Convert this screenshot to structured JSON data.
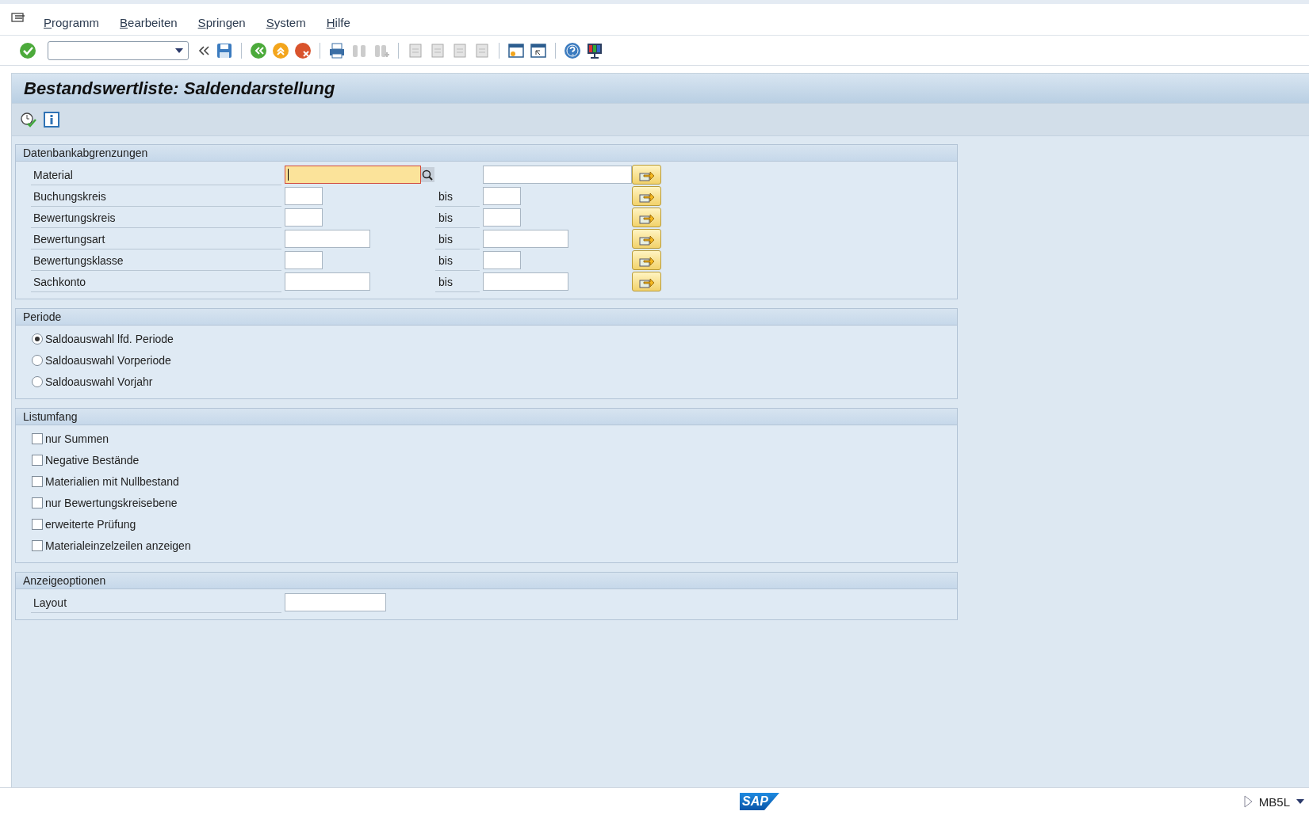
{
  "menu": [
    {
      "label": "Programm"
    },
    {
      "label": "Bearbeiten"
    },
    {
      "label": "Springen"
    },
    {
      "label": "System"
    },
    {
      "label": "Hilfe"
    }
  ],
  "title": "Bestandswertliste: Saldendarstellung",
  "groups": [
    {
      "title": "Datenbankabgrenzungen",
      "kind": "ranges",
      "rows": [
        {
          "label": "Material",
          "kind": "long",
          "focused": true,
          "search_help": true
        },
        {
          "label": "Buchungskreis",
          "kind": "short",
          "focused": false,
          "search_help": false,
          "to_label": "bis"
        },
        {
          "label": "Bewertungskreis",
          "kind": "short",
          "focused": false,
          "search_help": false,
          "to_label": "bis"
        },
        {
          "label": "Bewertungsart",
          "kind": "medium",
          "focused": false,
          "search_help": false,
          "to_label": "bis"
        },
        {
          "label": "Bewertungsklasse",
          "kind": "short",
          "focused": false,
          "search_help": false,
          "to_label": "bis"
        },
        {
          "label": "Sachkonto",
          "kind": "medium",
          "focused": false,
          "search_help": false,
          "to_label": "bis"
        }
      ]
    },
    {
      "title": "Periode",
      "kind": "radios",
      "rows": [
        {
          "label": "Saldoauswahl lfd. Periode",
          "selected": true
        },
        {
          "label": "Saldoauswahl Vorperiode",
          "selected": false
        },
        {
          "label": "Saldoauswahl Vorjahr",
          "selected": false
        }
      ]
    },
    {
      "title": "Listumfang",
      "kind": "checkboxes",
      "rows": [
        {
          "label": "nur Summen",
          "checked": false
        },
        {
          "label": "Negative Bestände",
          "checked": false
        },
        {
          "label": "Materialien mit Nullbestand",
          "checked": false
        },
        {
          "label": "nur Bewertungskreisebene",
          "checked": false
        },
        {
          "label": "erweiterte Prüfung",
          "checked": false
        },
        {
          "label": "Materialeinzelzeilen anzeigen",
          "checked": false
        }
      ]
    },
    {
      "title": "Anzeigeoptionen",
      "kind": "fields",
      "rows": [
        {
          "label": "Layout",
          "kind": "layout"
        }
      ]
    }
  ],
  "status_bar": {
    "logo": "SAP",
    "transaction": "MB5L"
  }
}
